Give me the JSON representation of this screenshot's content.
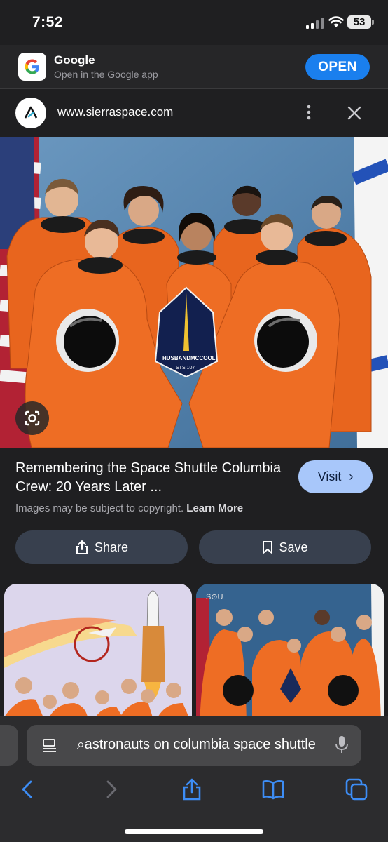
{
  "status_bar": {
    "time": "7:52",
    "battery": "53"
  },
  "app_banner": {
    "title": "Google",
    "subtitle": "Open in the Google app",
    "open_label": "OPEN"
  },
  "site_header": {
    "url": "www.sierraspace.com"
  },
  "result": {
    "title": "Remembering the Space Shuttle Columbia Crew: 20 Years Later ...",
    "visit_label": "Visit",
    "copyright_text": "Images may be subject to copyright.",
    "learn_more": "Learn More",
    "share_label": "Share",
    "save_label": "Save"
  },
  "hero_image": {
    "patch_names": [
      "HUSBAND",
      "MCCOOL",
      "STS 107"
    ]
  },
  "search_bar": {
    "query": "astronauts on columbia space shuttle"
  },
  "colors": {
    "accent": "#1a7fee",
    "visit": "#a8c7fa",
    "action_button": "#38404e",
    "suit_orange": "#e8651e"
  }
}
